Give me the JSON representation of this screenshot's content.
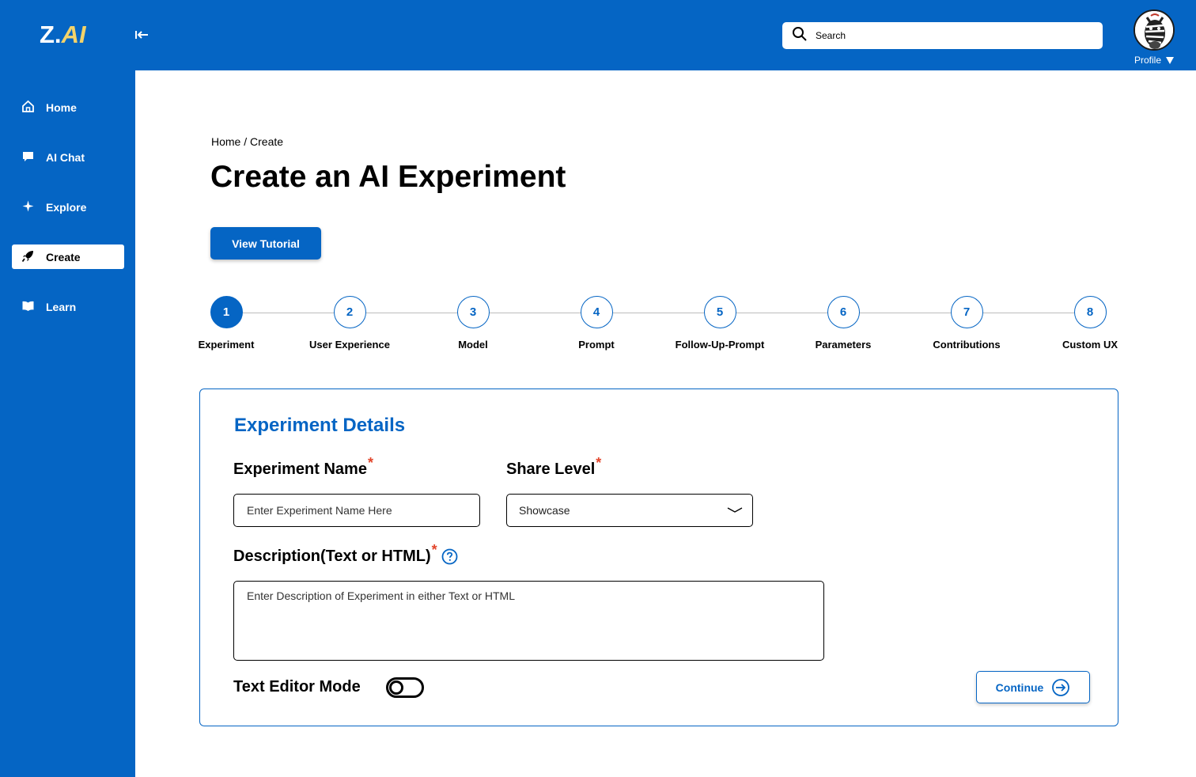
{
  "brand": {
    "prefix": "Z.",
    "suffix": "AI"
  },
  "header": {
    "search_placeholder": "Search",
    "profile_label": "Profile"
  },
  "sidebar": {
    "items": [
      {
        "label": "Home",
        "icon": "home-icon",
        "active": false
      },
      {
        "label": "AI Chat",
        "icon": "chat-bubble-icon",
        "active": false
      },
      {
        "label": "Explore",
        "icon": "sparkle-icon",
        "active": false
      },
      {
        "label": "Create",
        "icon": "rocket-icon",
        "active": true
      },
      {
        "label": "Learn",
        "icon": "book-icon",
        "active": false
      }
    ]
  },
  "breadcrumb": "Home / Create",
  "page_title": "Create an AI Experiment",
  "tutorial_button": "View Tutorial",
  "steps": [
    {
      "number": "1",
      "label": "Experiment",
      "active": true
    },
    {
      "number": "2",
      "label": "User Experience",
      "active": false
    },
    {
      "number": "3",
      "label": "Model",
      "active": false
    },
    {
      "number": "4",
      "label": "Prompt",
      "active": false
    },
    {
      "number": "5",
      "label": "Follow-Up-Prompt",
      "active": false
    },
    {
      "number": "6",
      "label": "Parameters",
      "active": false
    },
    {
      "number": "7",
      "label": "Contributions",
      "active": false
    },
    {
      "number": "8",
      "label": "Custom UX",
      "active": false
    }
  ],
  "card": {
    "title": "Experiment Details",
    "name_label": "Experiment Name",
    "name_placeholder": "Enter Experiment Name Here",
    "share_label": "Share Level",
    "share_value": "Showcase",
    "description_label": "Description(Text or HTML)",
    "description_placeholder": "Enter Description of Experiment in either Text or HTML",
    "editor_mode_label": "Text Editor Mode",
    "editor_mode_on": false,
    "continue_label": "Continue",
    "required_mark": "*"
  },
  "colors": {
    "primary": "#0565c4",
    "accent_logo": "#f3d36a",
    "required": "#e2452b"
  }
}
